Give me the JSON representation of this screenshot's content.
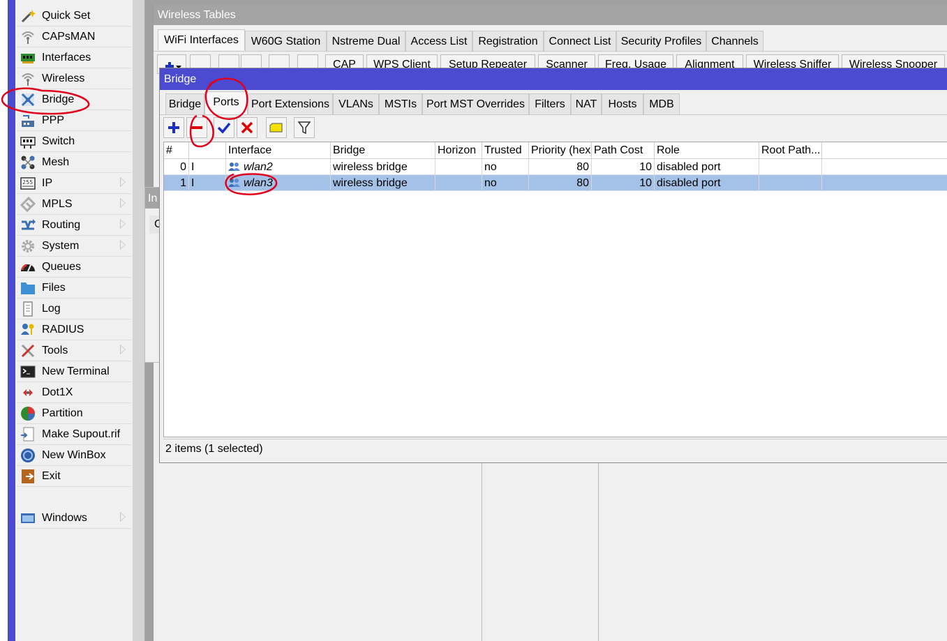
{
  "sidebar": {
    "items": [
      {
        "label": "Quick Set",
        "icon": "wand-icon",
        "submenu": false
      },
      {
        "label": "CAPsMAN",
        "icon": "antenna-icon",
        "submenu": false
      },
      {
        "label": "Interfaces",
        "icon": "network-card-icon",
        "submenu": false
      },
      {
        "label": "Wireless",
        "icon": "wifi-antenna-icon",
        "submenu": false
      },
      {
        "label": "Bridge",
        "icon": "bridge-icon",
        "submenu": false
      },
      {
        "label": "PPP",
        "icon": "ppp-icon",
        "submenu": false
      },
      {
        "label": "Switch",
        "icon": "switch-icon",
        "submenu": false
      },
      {
        "label": "Mesh",
        "icon": "mesh-icon",
        "submenu": false
      },
      {
        "label": "IP",
        "icon": "ip-icon",
        "submenu": true
      },
      {
        "label": "MPLS",
        "icon": "mpls-icon",
        "submenu": true
      },
      {
        "label": "Routing",
        "icon": "routing-icon",
        "submenu": true
      },
      {
        "label": "System",
        "icon": "gear-icon",
        "submenu": true
      },
      {
        "label": "Queues",
        "icon": "gauge-icon",
        "submenu": false
      },
      {
        "label": "Files",
        "icon": "folder-icon",
        "submenu": false
      },
      {
        "label": "Log",
        "icon": "log-icon",
        "submenu": false
      },
      {
        "label": "RADIUS",
        "icon": "users-icon",
        "submenu": false
      },
      {
        "label": "Tools",
        "icon": "tools-icon",
        "submenu": true
      },
      {
        "label": "New Terminal",
        "icon": "terminal-icon",
        "submenu": false
      },
      {
        "label": "Dot1X",
        "icon": "dot1x-icon",
        "submenu": false
      },
      {
        "label": "Partition",
        "icon": "pie-icon",
        "submenu": false
      },
      {
        "label": "Make Supout.rif",
        "icon": "export-icon",
        "submenu": false
      },
      {
        "label": "New WinBox",
        "icon": "globe-icon",
        "submenu": false
      },
      {
        "label": "Exit",
        "icon": "exit-icon",
        "submenu": false
      }
    ],
    "windows_label": "Windows"
  },
  "wireless_tables": {
    "title": "Wireless Tables",
    "tabs": [
      "WiFi Interfaces",
      "W60G Station",
      "Nstreme Dual",
      "Access List",
      "Registration",
      "Connect List",
      "Security Profiles",
      "Channels"
    ],
    "toolbar_buttons": [
      "CAP",
      "WPS Client",
      "Setup Repeater",
      "Scanner",
      "Freq. Usage",
      "Alignment",
      "Wireless Sniffer",
      "Wireless Snooper"
    ]
  },
  "behind_window": {
    "title": "In",
    "fragment": "C"
  },
  "bridge_window": {
    "title": "Bridge",
    "tabs": [
      "Bridge",
      "Ports",
      "Port Extensions",
      "VLANs",
      "MSTIs",
      "Port MST Overrides",
      "Filters",
      "NAT",
      "Hosts",
      "MDB"
    ],
    "active_tab": "Ports",
    "columns": [
      "#",
      "",
      "Interface",
      "Bridge",
      "Horizon",
      "Trusted",
      "Priority (hex)",
      "Path Cost",
      "Role",
      "Root Path..."
    ],
    "rows": [
      {
        "num": "0",
        "flag": "I",
        "interface": "wlan2",
        "bridge": "wireless bridge",
        "horizon": "",
        "trusted": "no",
        "priority": "80",
        "path_cost": "10",
        "role": "disabled port",
        "root_path": ""
      },
      {
        "num": "1",
        "flag": "I",
        "interface": "wlan3",
        "bridge": "wireless bridge",
        "horizon": "",
        "trusted": "no",
        "priority": "80",
        "path_cost": "10",
        "role": "disabled port",
        "root_path": "",
        "selected": true
      }
    ],
    "status": "2 items (1 selected)"
  },
  "colors": {
    "accent": "#4a4bd0",
    "selection": "#a4c2e8",
    "annotation": "#e0001b"
  }
}
